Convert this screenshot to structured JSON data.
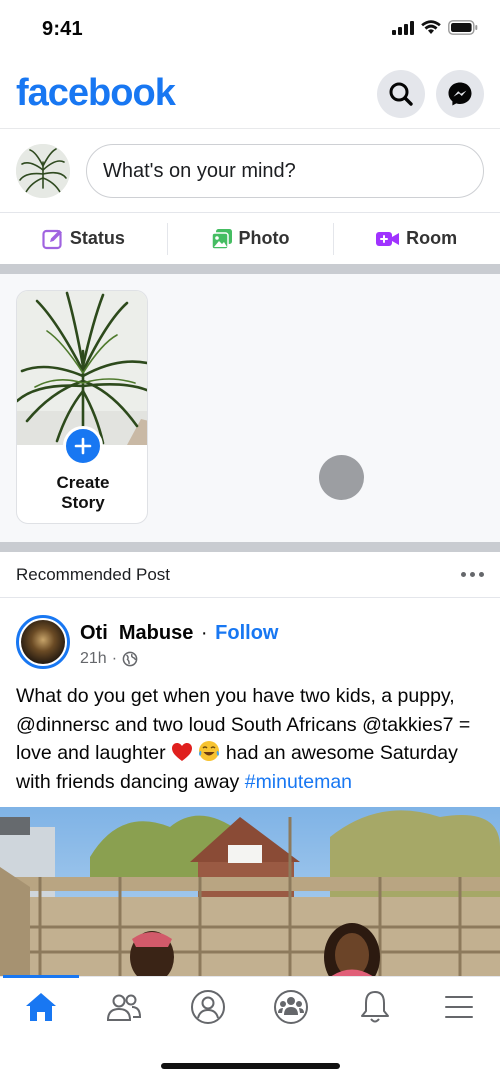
{
  "status_bar": {
    "time": "9:41"
  },
  "header": {
    "logo": "facebook",
    "search_icon": "search-icon",
    "messenger_icon": "messenger-icon"
  },
  "composer": {
    "placeholder": "What's on your mind?"
  },
  "actions": [
    {
      "label": "Status",
      "icon": "edit-icon",
      "color": "#a063e0"
    },
    {
      "label": "Photo",
      "icon": "photo-icon",
      "color": "#45bd62"
    },
    {
      "label": "Room",
      "icon": "video-room-icon",
      "color": "#a033ff"
    }
  ],
  "stories": {
    "create_line1": "Create",
    "create_line2": "Story"
  },
  "recommended": {
    "label": "Recommended Post"
  },
  "post": {
    "author": "Oti  Mabuse",
    "follow": "Follow",
    "time": "21h",
    "privacy_icon": "globe-icon",
    "text_part1": "What do you get when you have two kids, a puppy, @dinnersc and two loud South Africans @takkies7 = love and laughter",
    "text_part2": "had an awesome Saturday with friends dancing away",
    "hashtag": "#minuteman"
  },
  "bottom_nav": [
    "home-icon",
    "friends-icon",
    "profile-icon",
    "groups-icon",
    "notifications-icon",
    "menu-icon"
  ],
  "colors": {
    "brand": "#1877f2",
    "separator": "#c9ccd1",
    "muted_text": "#65676b"
  }
}
